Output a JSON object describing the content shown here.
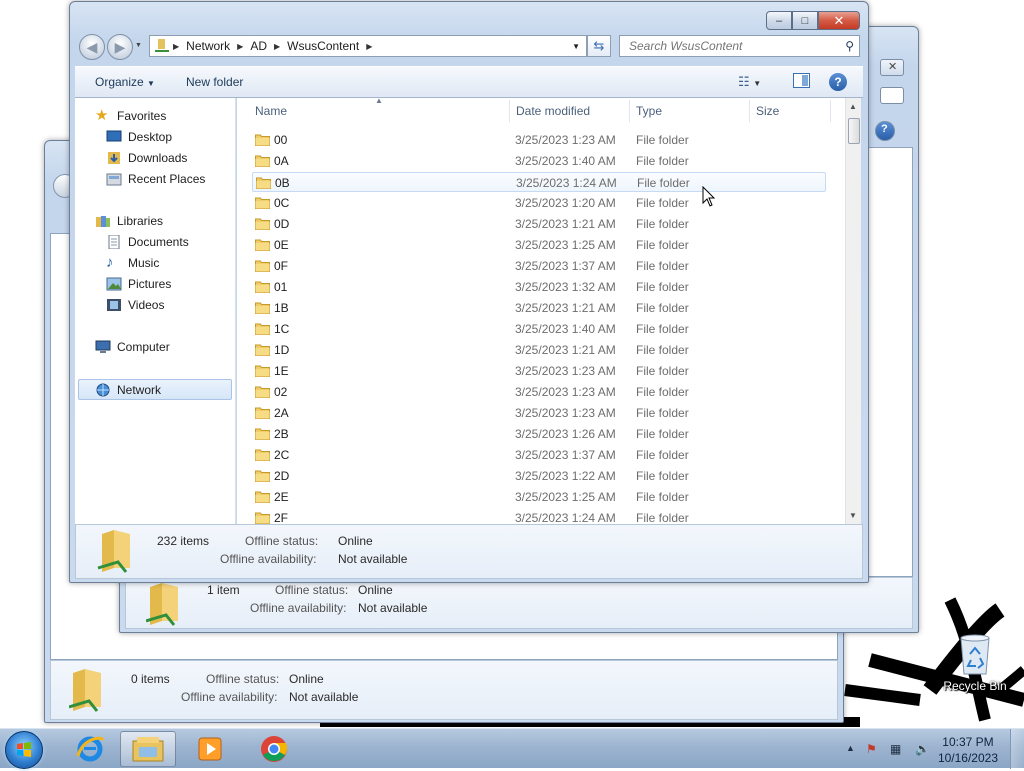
{
  "explorer": {
    "path": [
      "Network",
      "AD",
      "WsusContent"
    ],
    "search_placeholder": "Search WsusContent",
    "toolbar": {
      "organize": "Organize",
      "new_folder": "New folder"
    },
    "caption": {
      "minimize": "–",
      "maximize": "□",
      "close": "✕"
    },
    "columns": {
      "name": "Name",
      "date": "Date modified",
      "type": "Type",
      "size": "Size"
    },
    "nav": {
      "favorites": "Favorites",
      "desktop": "Desktop",
      "downloads": "Downloads",
      "recent": "Recent Places",
      "libraries": "Libraries",
      "documents": "Documents",
      "music": "Music",
      "pictures": "Pictures",
      "videos": "Videos",
      "computer": "Computer",
      "network": "Network"
    },
    "rows": [
      {
        "name": "00",
        "date": "3/25/2023 1:23 AM",
        "type": "File folder"
      },
      {
        "name": "0A",
        "date": "3/25/2023 1:40 AM",
        "type": "File folder"
      },
      {
        "name": "0B",
        "date": "3/25/2023 1:24 AM",
        "type": "File folder"
      },
      {
        "name": "0C",
        "date": "3/25/2023 1:20 AM",
        "type": "File folder"
      },
      {
        "name": "0D",
        "date": "3/25/2023 1:21 AM",
        "type": "File folder"
      },
      {
        "name": "0E",
        "date": "3/25/2023 1:25 AM",
        "type": "File folder"
      },
      {
        "name": "0F",
        "date": "3/25/2023 1:37 AM",
        "type": "File folder"
      },
      {
        "name": "01",
        "date": "3/25/2023 1:32 AM",
        "type": "File folder"
      },
      {
        "name": "1B",
        "date": "3/25/2023 1:21 AM",
        "type": "File folder"
      },
      {
        "name": "1C",
        "date": "3/25/2023 1:40 AM",
        "type": "File folder"
      },
      {
        "name": "1D",
        "date": "3/25/2023 1:21 AM",
        "type": "File folder"
      },
      {
        "name": "1E",
        "date": "3/25/2023 1:23 AM",
        "type": "File folder"
      },
      {
        "name": "02",
        "date": "3/25/2023 1:23 AM",
        "type": "File folder"
      },
      {
        "name": "2A",
        "date": "3/25/2023 1:23 AM",
        "type": "File folder"
      },
      {
        "name": "2B",
        "date": "3/25/2023 1:26 AM",
        "type": "File folder"
      },
      {
        "name": "2C",
        "date": "3/25/2023 1:37 AM",
        "type": "File folder"
      },
      {
        "name": "2D",
        "date": "3/25/2023 1:22 AM",
        "type": "File folder"
      },
      {
        "name": "2E",
        "date": "3/25/2023 1:25 AM",
        "type": "File folder"
      },
      {
        "name": "2F",
        "date": "3/25/2023 1:24 AM",
        "type": "File folder"
      }
    ],
    "details": {
      "count": "232 items",
      "status_key": "Offline status:",
      "status_val": "Online",
      "avail_key": "Offline availability:",
      "avail_val": "Not available"
    }
  },
  "back_window_1": {
    "count": "1 item",
    "status_key": "Offline status:",
    "status_val": "Online",
    "avail_key": "Offline availability:",
    "avail_val": "Not available"
  },
  "back_window_2": {
    "count": "0 items",
    "status_key": "Offline status:",
    "status_val": "Online",
    "avail_key": "Offline availability:",
    "avail_val": "Not available"
  },
  "desktop": {
    "recycle_bin": "Recycle Bin"
  },
  "taskbar": {
    "apps": [
      "windows-explorer",
      "internet-explorer",
      "file-explorer",
      "media-player",
      "chrome"
    ],
    "time": "10:37 PM",
    "date": "10/16/2023"
  },
  "colors": {
    "accent": "#3a6fb0",
    "selection": "#d6e6f8",
    "taskbar": "#9db4d0"
  }
}
